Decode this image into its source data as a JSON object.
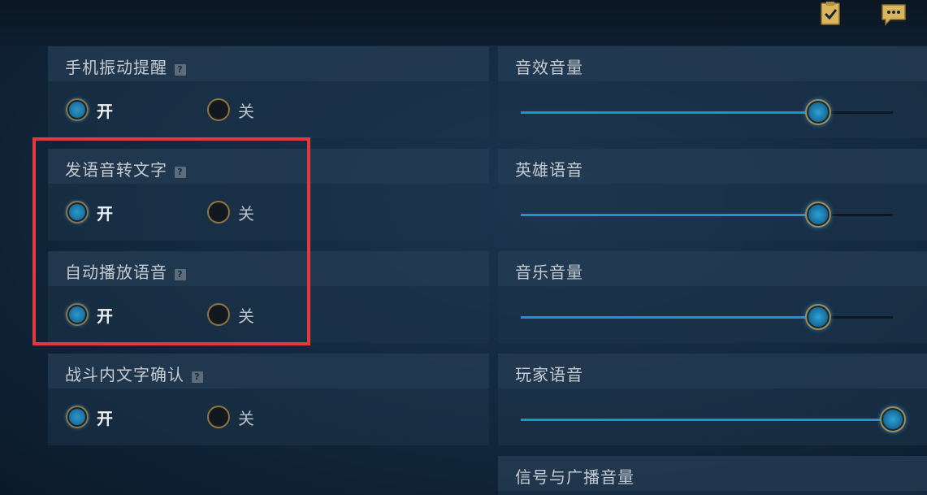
{
  "toggles": [
    {
      "title": "手机振动提醒",
      "on_label": "开",
      "off_label": "关",
      "selected": "on"
    },
    {
      "title": "发语音转文字",
      "on_label": "开",
      "off_label": "关",
      "selected": "on"
    },
    {
      "title": "自动播放语音",
      "on_label": "开",
      "off_label": "关",
      "selected": "on"
    },
    {
      "title": "战斗内文字确认",
      "on_label": "开",
      "off_label": "关",
      "selected": "on"
    }
  ],
  "help_glyph": "?",
  "sliders": [
    {
      "title": "音效音量",
      "value": 0.8
    },
    {
      "title": "英雄语音",
      "value": 0.8
    },
    {
      "title": "音乐音量",
      "value": 0.8
    },
    {
      "title": "玩家语音",
      "value": 1.0
    },
    {
      "title": "信号与广播音量"
    }
  ],
  "icons": {
    "top_left": "clipboard-check-icon",
    "top_right": "chat-bubble-icon"
  },
  "colors": {
    "accent": "#1c95cf",
    "gold": "#a58a52",
    "highlight_border": "#e23a3a"
  }
}
